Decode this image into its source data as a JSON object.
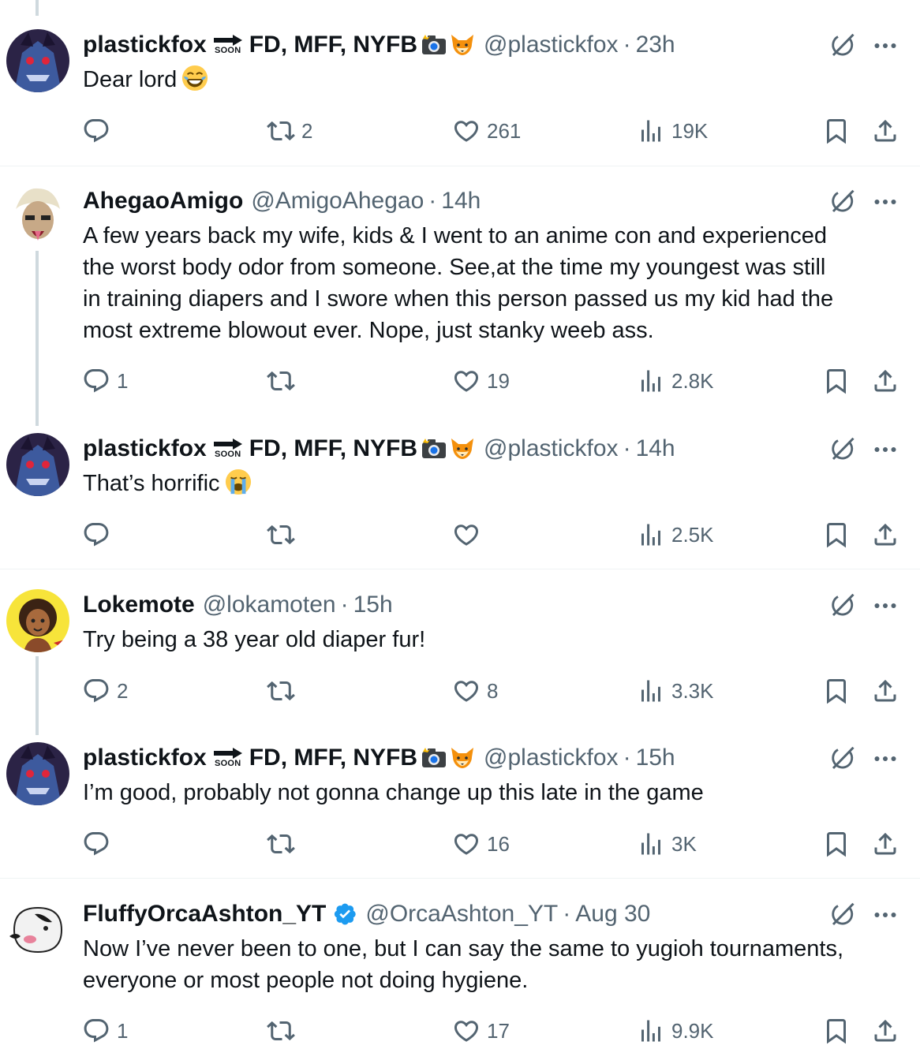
{
  "colors": {
    "text": "#0f1419",
    "secondary": "#536471",
    "verified": "#1d9bf0",
    "divider": "#eff3f4",
    "thread_line": "#cfd9de"
  },
  "badge_soon": "SOON",
  "icons": {
    "reply": "reply-icon",
    "retweet": "retweet-icon",
    "like": "heart-icon",
    "views": "views-icon",
    "bookmark": "bookmark-icon",
    "share": "share-icon",
    "grok": "grok-icon",
    "more": "more-icon"
  },
  "tweets": [
    {
      "name": "plastickfox",
      "name_suffix": "FD, MFF, NYFB",
      "handle": "@plastickfox",
      "time": "23h",
      "text": "Dear lord",
      "reply_count": "",
      "retweet_count": "2",
      "like_count": "261",
      "view_count": "19K"
    },
    {
      "name": "AhegaoAmigo",
      "handle": "@AmigoAhegao",
      "time": "14h",
      "text_lines": [
        "A few years back my wife, kids & I went to an anime con and experienced",
        "the worst body odor from someone. See,at the time my youngest was still",
        "in training diapers and I swore when this person passed us my kid had the",
        "most extreme blowout ever. Nope, just stanky weeb ass."
      ],
      "reply_count": "1",
      "retweet_count": "",
      "like_count": "19",
      "view_count": "2.8K"
    },
    {
      "name": "plastickfox",
      "name_suffix": "FD, MFF, NYFB",
      "handle": "@plastickfox",
      "time": "14h",
      "text": "That’s horrific",
      "reply_count": "",
      "retweet_count": "",
      "like_count": "",
      "view_count": "2.5K"
    },
    {
      "name": "Lokemote",
      "handle": "@lokamoten",
      "time": "15h",
      "text": "Try being a 38 year old diaper fur!",
      "reply_count": "2",
      "retweet_count": "",
      "like_count": "8",
      "view_count": "3.3K"
    },
    {
      "name": "plastickfox",
      "name_suffix": "FD, MFF, NYFB",
      "handle": "@plastickfox",
      "time": "15h",
      "text": "I’m good, probably not gonna change up this late in the game",
      "reply_count": "",
      "retweet_count": "",
      "like_count": "16",
      "view_count": "3K"
    },
    {
      "name": "FluffyOrcaAshton_YT",
      "handle": "@OrcaAshton_YT",
      "time": "Aug 30",
      "text_lines": [
        "Now I’ve never been to one, but I can say the same to yugioh tournaments,",
        "everyone or most people not doing hygiene."
      ],
      "reply_count": "1",
      "retweet_count": "",
      "like_count": "17",
      "view_count": "9.9K"
    }
  ]
}
